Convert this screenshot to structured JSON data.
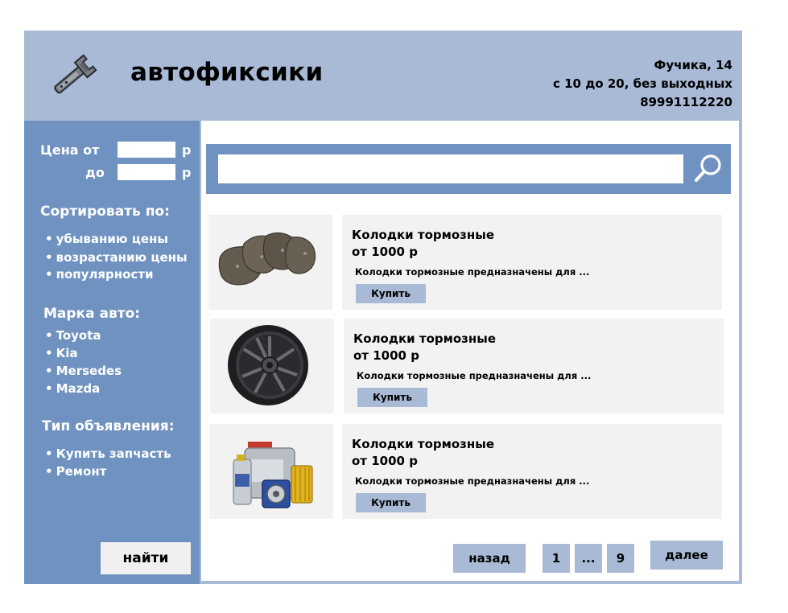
{
  "header": {
    "brand": "автофиксики",
    "address": "Фучика, 14",
    "hours": "с 10 до 20, без выходных",
    "phone": "89991112220",
    "logo_icon": "wrench-icon"
  },
  "filters": {
    "price_from_label": "Цена от",
    "price_to_label": "до",
    "currency": "р",
    "price_from_value": "",
    "price_to_value": "",
    "sort_title": "Сортировать по:",
    "sort_options": [
      "убыванию цены",
      "возрастанию цены",
      "популярности"
    ],
    "brand_title": "Марка авто:",
    "brands": [
      "Toyota",
      "Kia",
      "Mersedes",
      "Mazda"
    ],
    "type_title": "Тип объявления:",
    "types": [
      "Купить запчасть",
      "Ремонт"
    ],
    "find_label": "найти"
  },
  "search": {
    "value": "",
    "placeholder": "",
    "icon": "search-icon"
  },
  "products": [
    {
      "title": "Колодки тормозные",
      "price": "от 1000 р",
      "description": "Колодки тормозные предназначены для ...",
      "buy_label": "Купить",
      "image": "brake-pads-image"
    },
    {
      "title": "Колодки тормозные",
      "price": "от 1000 р",
      "description": "Колодки тормозные предназначены для ...",
      "buy_label": "Купить",
      "image": "wheel-rim-image"
    },
    {
      "title": "Колодки тормозные",
      "price": "от 1000 р",
      "description": "Колодки тормозные предназначены для ...",
      "buy_label": "Купить",
      "image": "oil-and-filters-image"
    }
  ],
  "pagination": {
    "back": "назад",
    "pages": [
      "1",
      "...",
      "9"
    ],
    "next": "далее"
  },
  "colors": {
    "light_blue": "#a8bad6",
    "mid_blue": "#6f92c1",
    "card_gray": "#f2f2f2"
  }
}
